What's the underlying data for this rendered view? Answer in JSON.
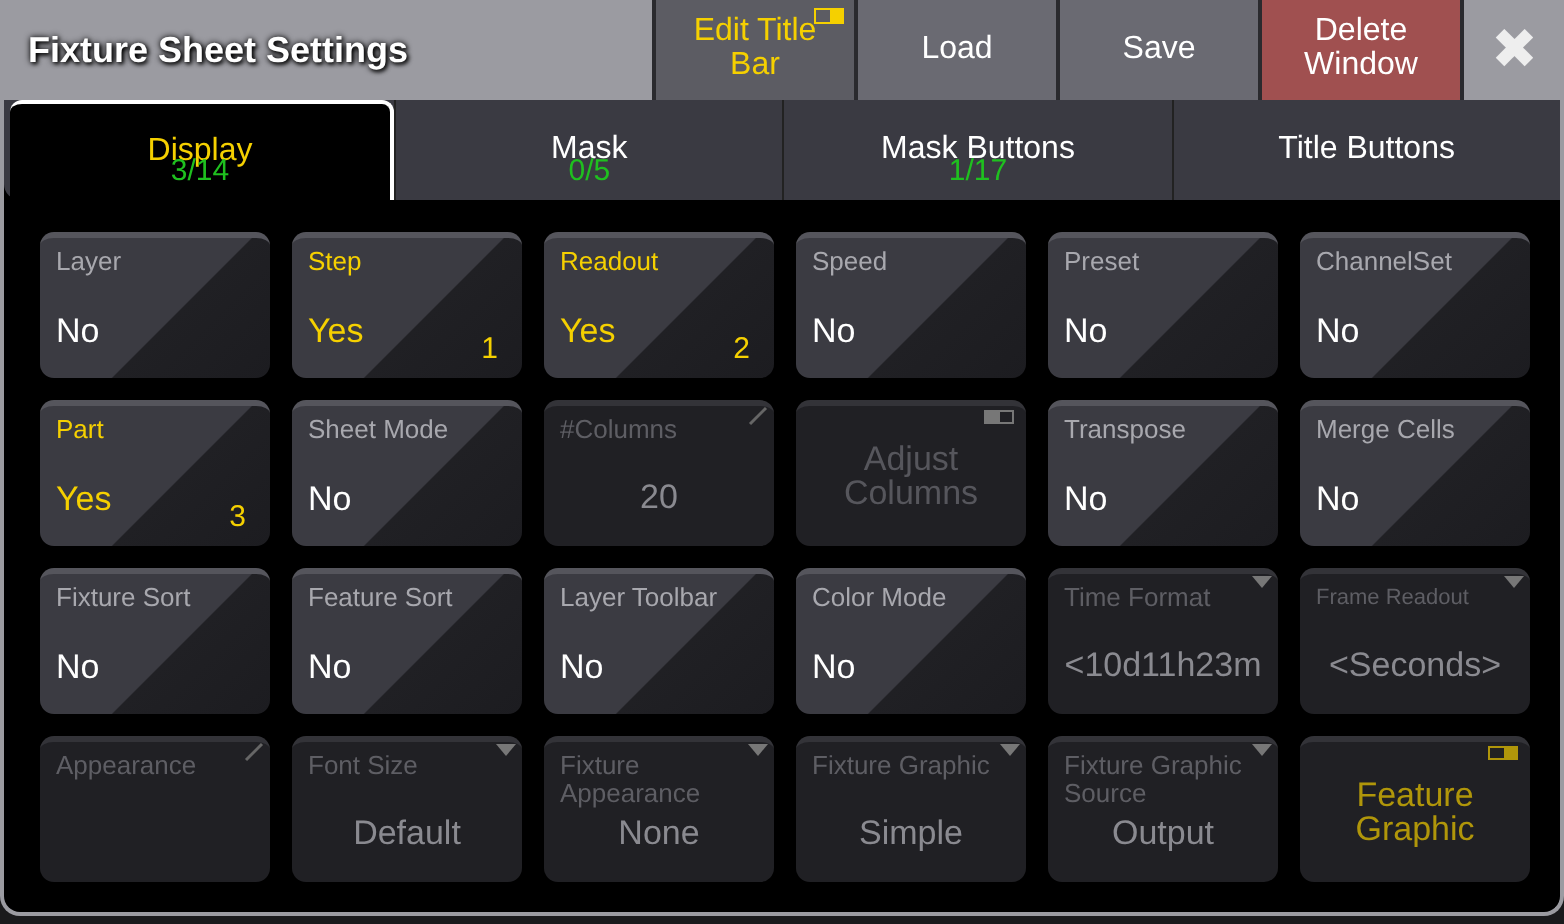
{
  "window": {
    "title": "Fixture Sheet Settings"
  },
  "title_buttons": [
    {
      "kind": "switch",
      "label": "Edit Title Bar",
      "switch_on": true
    },
    {
      "kind": "plain",
      "label": "Load"
    },
    {
      "kind": "plain",
      "label": "Save"
    },
    {
      "kind": "danger",
      "label": "Delete Window"
    },
    {
      "kind": "close",
      "label": "✖"
    }
  ],
  "tabs": [
    {
      "label": "Display",
      "count": "3/14",
      "selected": true
    },
    {
      "label": "Mask",
      "count": "0/5",
      "selected": false
    },
    {
      "label": "Mask Buttons",
      "count": "1/17",
      "selected": false
    },
    {
      "label": "Title Buttons",
      "selected": false
    }
  ],
  "tiles": [
    {
      "kind": "toggle",
      "label": "Layer",
      "value": "No",
      "active": false,
      "disabled": false
    },
    {
      "kind": "toggle",
      "label": "Step",
      "value": "Yes",
      "order": "1",
      "active": true,
      "disabled": false
    },
    {
      "kind": "toggle",
      "label": "Readout",
      "value": "Yes",
      "order": "2",
      "active": true,
      "disabled": false
    },
    {
      "kind": "toggle",
      "label": "Speed",
      "value": "No",
      "active": false,
      "disabled": false
    },
    {
      "kind": "toggle",
      "label": "Preset",
      "value": "No",
      "active": false,
      "disabled": false
    },
    {
      "kind": "toggle",
      "label": "ChannelSet",
      "value": "No",
      "active": false,
      "disabled": false
    },
    {
      "kind": "toggle",
      "label": "Part",
      "value": "Yes",
      "order": "3",
      "active": true,
      "disabled": false
    },
    {
      "kind": "toggle",
      "label": "Sheet Mode",
      "value": "No",
      "active": false,
      "disabled": false
    },
    {
      "kind": "field",
      "label": "#Columns",
      "value": "20",
      "active": false,
      "disabled": true
    },
    {
      "kind": "switch",
      "value": "Adjust Columns",
      "switch_on": false,
      "active": false,
      "disabled": true
    },
    {
      "kind": "toggle",
      "label": "Transpose",
      "value": "No",
      "active": false,
      "disabled": false
    },
    {
      "kind": "toggle",
      "label": "Merge Cells",
      "value": "No",
      "active": false,
      "disabled": false
    },
    {
      "kind": "toggle",
      "label": "Fixture Sort",
      "value": "No",
      "active": false,
      "disabled": false
    },
    {
      "kind": "toggle",
      "label": "Feature Sort",
      "value": "No",
      "active": false,
      "disabled": false
    },
    {
      "kind": "toggle",
      "label": "Layer Toolbar",
      "value": "No",
      "active": false,
      "disabled": false
    },
    {
      "kind": "toggle",
      "label": "Color Mode",
      "value": "No",
      "active": false,
      "disabled": false
    },
    {
      "kind": "dropdown",
      "label": "Time Format",
      "value": "<10d11h23m",
      "active": false,
      "disabled": true
    },
    {
      "kind": "dropdown",
      "label": "Frame Readout",
      "value": "<Seconds>",
      "small_label": true,
      "active": false,
      "disabled": true
    },
    {
      "kind": "field",
      "label": "Appearance",
      "active": false,
      "disabled": true
    },
    {
      "kind": "dropdown",
      "label": "Font Size",
      "value": "Default",
      "active": false,
      "disabled": true
    },
    {
      "kind": "dropdown",
      "label": "Fixture Appearance",
      "value": "None",
      "active": false,
      "disabled": true
    },
    {
      "kind": "dropdown",
      "label": "Fixture Graphic",
      "value": "Simple",
      "active": false,
      "disabled": true
    },
    {
      "kind": "dropdown",
      "label": "Fixture Graphic Source",
      "value": "Output",
      "active": false,
      "disabled": true
    },
    {
      "kind": "switch",
      "value": "Feature Graphic",
      "switch_on": true,
      "active": true,
      "disabled": true
    }
  ]
}
